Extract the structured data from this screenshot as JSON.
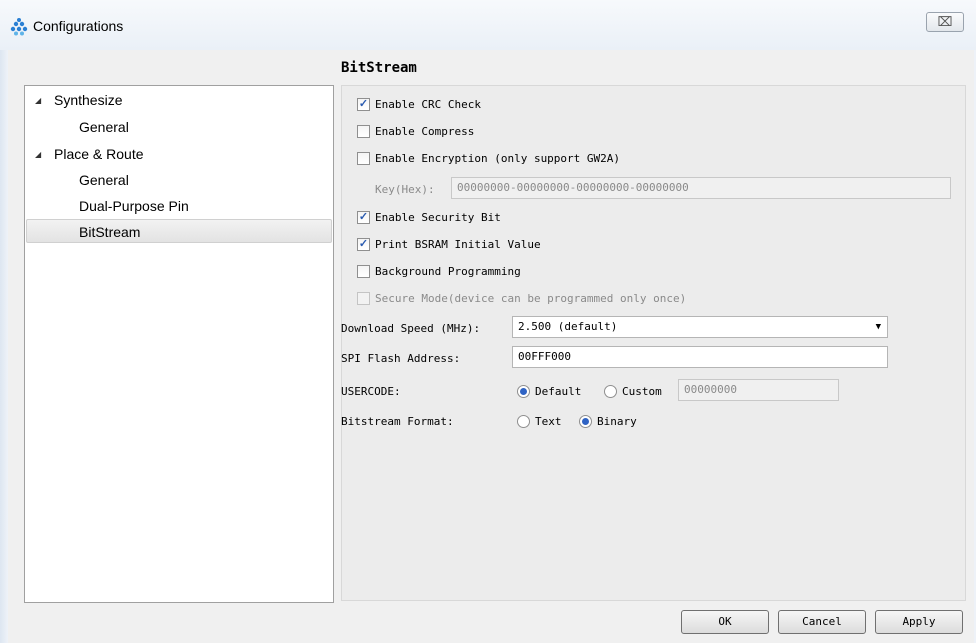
{
  "window": {
    "title": "Configurations",
    "close_glyph": "⌧"
  },
  "tree": {
    "items": [
      {
        "label": "Synthesize",
        "expanded": true,
        "level": 0
      },
      {
        "label": "General",
        "level": 1
      },
      {
        "label": "Place & Route",
        "expanded": true,
        "level": 0
      },
      {
        "label": "General",
        "level": 1
      },
      {
        "label": "Dual-Purpose Pin",
        "level": 1
      },
      {
        "label": "BitStream",
        "level": 1,
        "selected": true
      }
    ],
    "arrow": "◢"
  },
  "panel": {
    "title": "BitStream",
    "enable_crc": {
      "label": "Enable CRC Check",
      "checked": true
    },
    "enable_compress": {
      "label": "Enable Compress",
      "checked": false
    },
    "enable_encryption": {
      "label": "Enable Encryption (only support GW2A)",
      "checked": false
    },
    "key": {
      "label": "Key(Hex):",
      "value": "00000000-00000000-00000000-00000000"
    },
    "enable_security": {
      "label": "Enable Security Bit",
      "checked": true
    },
    "print_bsram": {
      "label": "Print BSRAM Initial Value",
      "checked": true
    },
    "background_prog": {
      "label": "Background Programming",
      "checked": false
    },
    "secure_mode": {
      "label": "Secure Mode(device can be programmed only once)",
      "checked": false,
      "disabled": true
    },
    "download_speed": {
      "label": "Download Speed (MHz):",
      "value": "2.500 (default)"
    },
    "spi_flash": {
      "label": "SPI Flash Address:",
      "value": "00FFF000"
    },
    "usercode": {
      "label": "USERCODE:",
      "default_label": "Default",
      "custom_label": "Custom",
      "value": "00000000",
      "selected": "Default"
    },
    "bitstream_format": {
      "label": "Bitstream Format:",
      "text_label": "Text",
      "binary_label": "Binary",
      "selected": "Binary"
    }
  },
  "buttons": {
    "ok": "OK",
    "cancel": "Cancel",
    "apply": "Apply"
  },
  "colors": {
    "accent": "#2f63c4",
    "check": "#2a5bb0"
  }
}
